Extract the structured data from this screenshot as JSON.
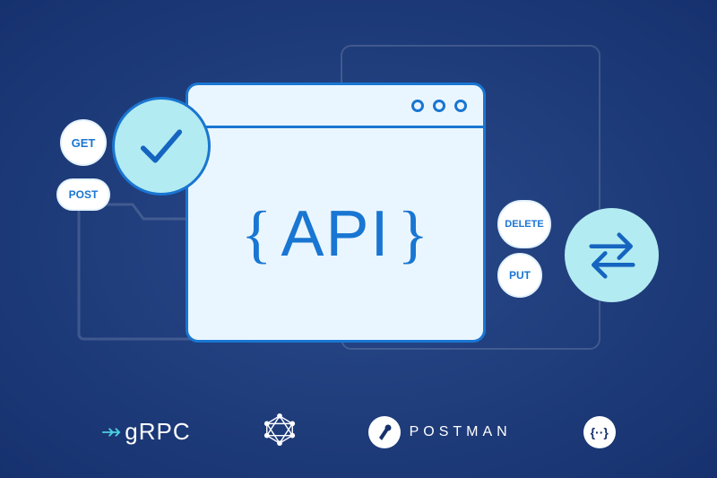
{
  "main": {
    "api_text": "API"
  },
  "methods": {
    "get": "GET",
    "post": "POST",
    "delete": "DELETE",
    "put": "PUT"
  },
  "logos": {
    "grpc": "gRPC",
    "postman": "POSTMAN",
    "swagger": "{··}"
  }
}
